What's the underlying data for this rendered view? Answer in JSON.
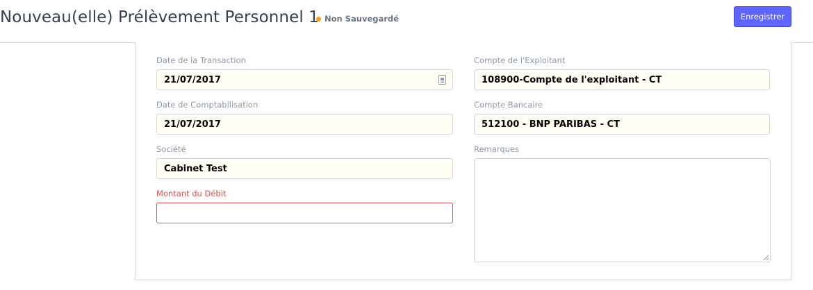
{
  "header": {
    "title": "Nouveau(elle) Prélèvement Personnel 1",
    "status": "Non Sauvegardé",
    "status_color": "#ffa00a",
    "save_label": "Enregistrer"
  },
  "form": {
    "left": [
      {
        "label": "Date de la Transaction",
        "value": "21/07/2017",
        "icon": "calendar-icon"
      },
      {
        "label": "Date de Comptabilisation",
        "value": "21/07/2017"
      },
      {
        "label": "Société",
        "value": "Cabinet Test"
      },
      {
        "label": "Montant du Débit",
        "value": "",
        "required_error": true
      }
    ],
    "right": [
      {
        "label": "Compte de l'Exploitant",
        "value": "108900-Compte de l'exploitant - CT"
      },
      {
        "label": "Compte Bancaire",
        "value": "512100 - BNP PARIBAS - CT"
      },
      {
        "label": "Remarques",
        "value": ""
      }
    ]
  },
  "colors": {
    "primary": "#5e64ff",
    "error": "#e24c4c",
    "input_bg": "#fffdf4"
  }
}
